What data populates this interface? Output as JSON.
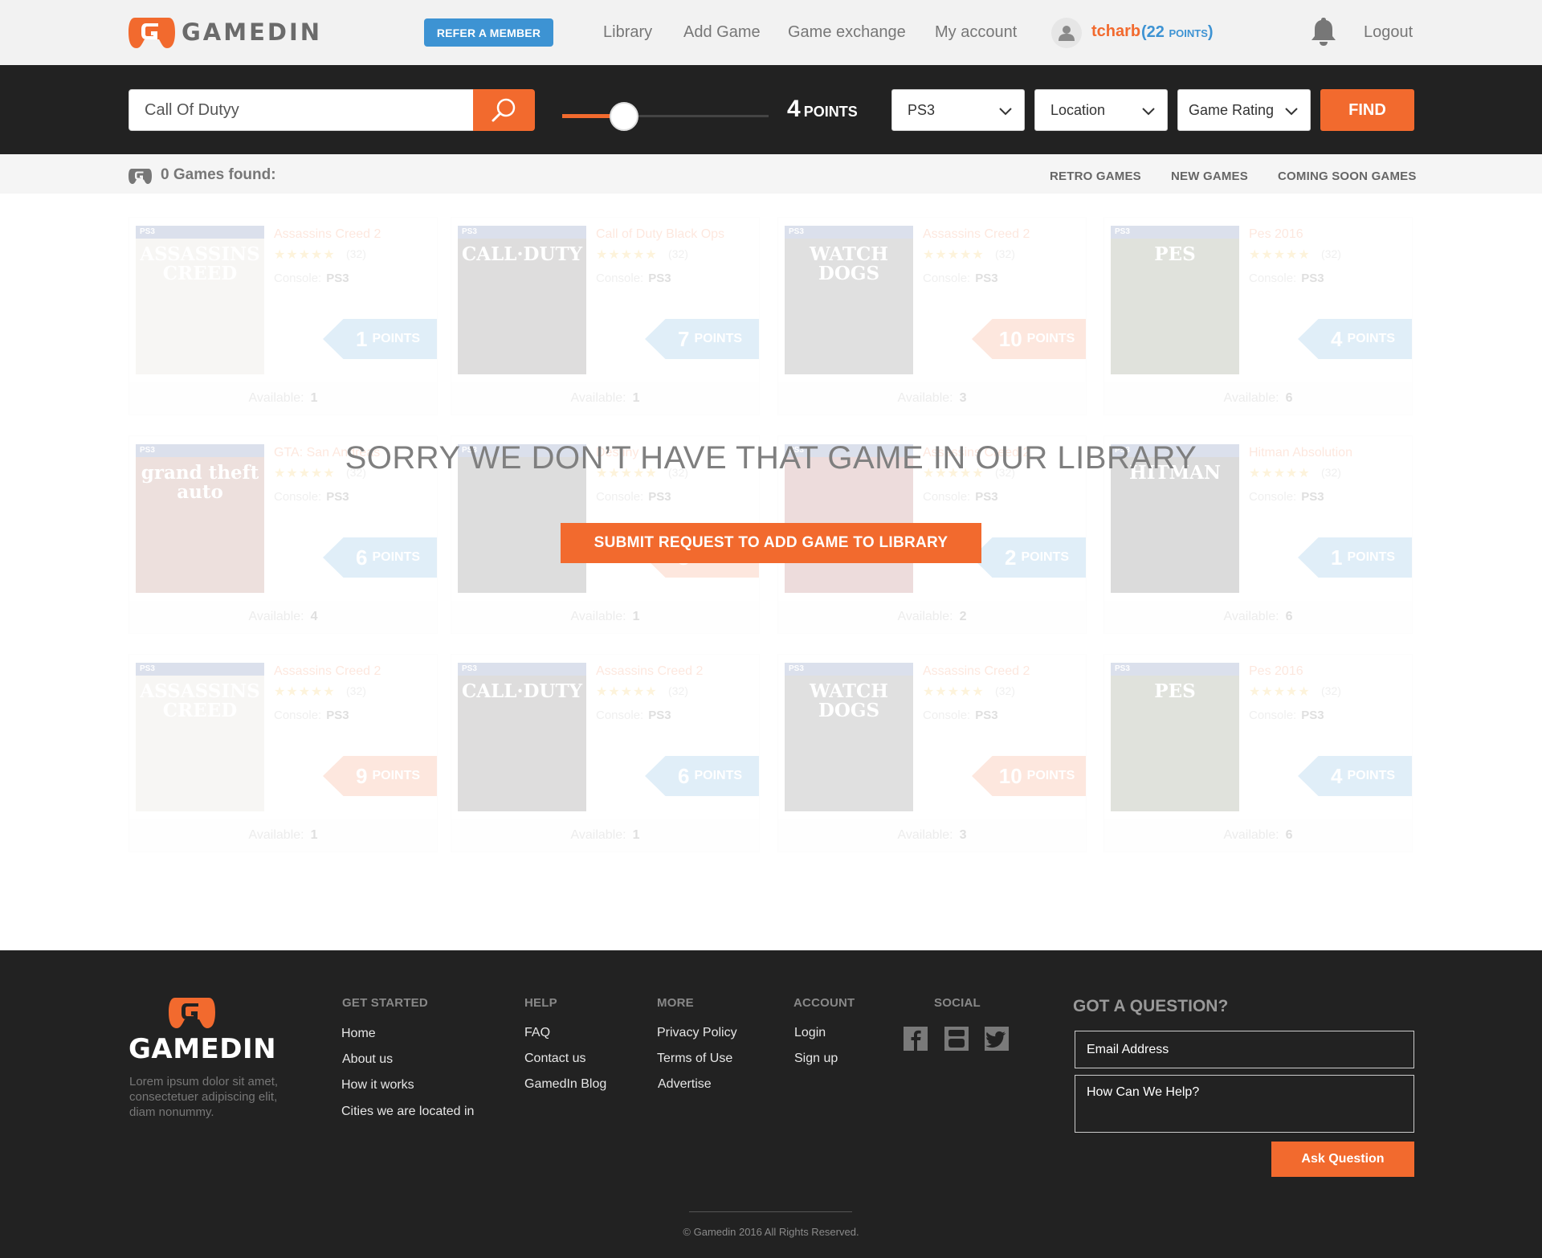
{
  "header": {
    "logo_text": "GAMEDIN",
    "refer_label": "REFER A MEMBER",
    "nav": [
      {
        "label": "Library"
      },
      {
        "label": "Add Game"
      },
      {
        "label": "Game exchange"
      },
      {
        "label": "My account"
      }
    ],
    "username": "tcharb",
    "points_open": "(22 ",
    "points_unit": "POINTS",
    "points_close": ")",
    "logout": "Logout"
  },
  "search": {
    "query": "Call Of Dutyy",
    "points_value": "4",
    "points_label": "POINTS",
    "slider_fraction": 0.3,
    "platform": "PS3",
    "location": "Location",
    "rating": "Game Rating",
    "find_label": "FIND"
  },
  "results": {
    "count_text": "0 Games found:",
    "filters": [
      "RETRO GAMES",
      "NEW GAMES",
      "COMING SOON GAMES"
    ]
  },
  "games": [
    {
      "title": "Assassins Creed 2",
      "cover": "ASSASSINS CREED",
      "rating": "(32)",
      "console": "PS3",
      "points": "1",
      "tag": "blue",
      "available": "1",
      "cover_color": "#c9c2ba"
    },
    {
      "title": "Call of Duty Black Ops",
      "cover": "CALL·DUTY",
      "rating": "(32)",
      "console": "PS3",
      "points": "7",
      "tag": "blue",
      "available": "1",
      "cover_color": "#2c2b27"
    },
    {
      "title": "Assassins Creed 2",
      "cover": "WATCH DOGS",
      "rating": "(32)",
      "console": "PS3",
      "points": "10",
      "tag": "orange",
      "available": "3",
      "cover_color": "#3a3a3a"
    },
    {
      "title": "Pes 2016",
      "cover": "PES",
      "rating": "(32)",
      "console": "PS3",
      "points": "4",
      "tag": "blue",
      "available": "6",
      "cover_color": "#3b4a22"
    },
    {
      "title": "GTA: San Andreas",
      "cover": "grand theft auto",
      "rating": "(32)",
      "console": "PS3",
      "points": "6",
      "tag": "blue",
      "available": "4",
      "cover_color": "#8d3b2a"
    },
    {
      "title": "Destiny",
      "cover": "",
      "rating": "(32)",
      "console": "PS3",
      "points": "3",
      "tag": "orange",
      "available": "1",
      "cover_color": "#2a2a2a"
    },
    {
      "title": "Assassins Creed 2",
      "cover": "",
      "rating": "(32)",
      "console": "PS3",
      "points": "2",
      "tag": "blue",
      "available": "2",
      "cover_color": "#8b2020"
    },
    {
      "title": "Hitman Absolution",
      "cover": "HITMAN",
      "rating": "(32)",
      "console": "PS3",
      "points": "1",
      "tag": "blue",
      "available": "6",
      "cover_color": "#1f1f1f"
    },
    {
      "title": "Assassins Creed 2",
      "cover": "ASSASSINS CREED",
      "rating": "(32)",
      "console": "PS3",
      "points": "9",
      "tag": "orange",
      "available": "1",
      "cover_color": "#c9c2ba"
    },
    {
      "title": "Assassins Creed 2",
      "cover": "CALL·DUTY",
      "rating": "(32)",
      "console": "PS3",
      "points": "6",
      "tag": "blue",
      "available": "1",
      "cover_color": "#2c2b27"
    },
    {
      "title": "Assassins Creed 2",
      "cover": "WATCH DOGS",
      "rating": "(32)",
      "console": "PS3",
      "points": "10",
      "tag": "orange",
      "available": "3",
      "cover_color": "#3a3a3a"
    },
    {
      "title": "Pes 2016",
      "cover": "PES",
      "rating": "(32)",
      "console": "PS3",
      "points": "4",
      "tag": "blue",
      "available": "6",
      "cover_color": "#3b4a22"
    }
  ],
  "card_labels": {
    "console_prefix": "Console:",
    "points_suffix": "POINTS",
    "available_prefix": "Available:",
    "stars": "★★★★★"
  },
  "message": {
    "title": "SORRY WE DON’T HAVE THAT GAME IN OUR LIBRARY",
    "button": "SUBMIT REQUEST TO ADD GAME TO LIBRARY"
  },
  "footer": {
    "logo_text": "GAMEDIN",
    "about": "Lorem ipsum dolor sit amet, consectetuer adipiscing elit, diam nonummy.",
    "columns": [
      {
        "heading": "GET STARTED",
        "links": [
          "Home",
          "About us",
          "How it works",
          "Cities we are located in"
        ]
      },
      {
        "heading": "HELP",
        "links": [
          "FAQ",
          "Contact us",
          "GamedIn Blog"
        ]
      },
      {
        "heading": "MORE",
        "links": [
          "Privacy Policy",
          "Terms of Use",
          "Advertise"
        ]
      },
      {
        "heading": "ACCOUNT",
        "links": [
          "Login",
          "Sign up"
        ]
      }
    ],
    "social_heading": "SOCIAL",
    "question_heading": "GOT A QUESTION?",
    "email_placeholder": "Email Address",
    "help_placeholder": "How Can We Help?",
    "ask_button": "Ask Question",
    "copyright": "© Gamedin 2016 All Rights Reserved."
  },
  "colors": {
    "accent": "#f26a2e",
    "blue": "#3d93d3",
    "dark": "#222222"
  }
}
